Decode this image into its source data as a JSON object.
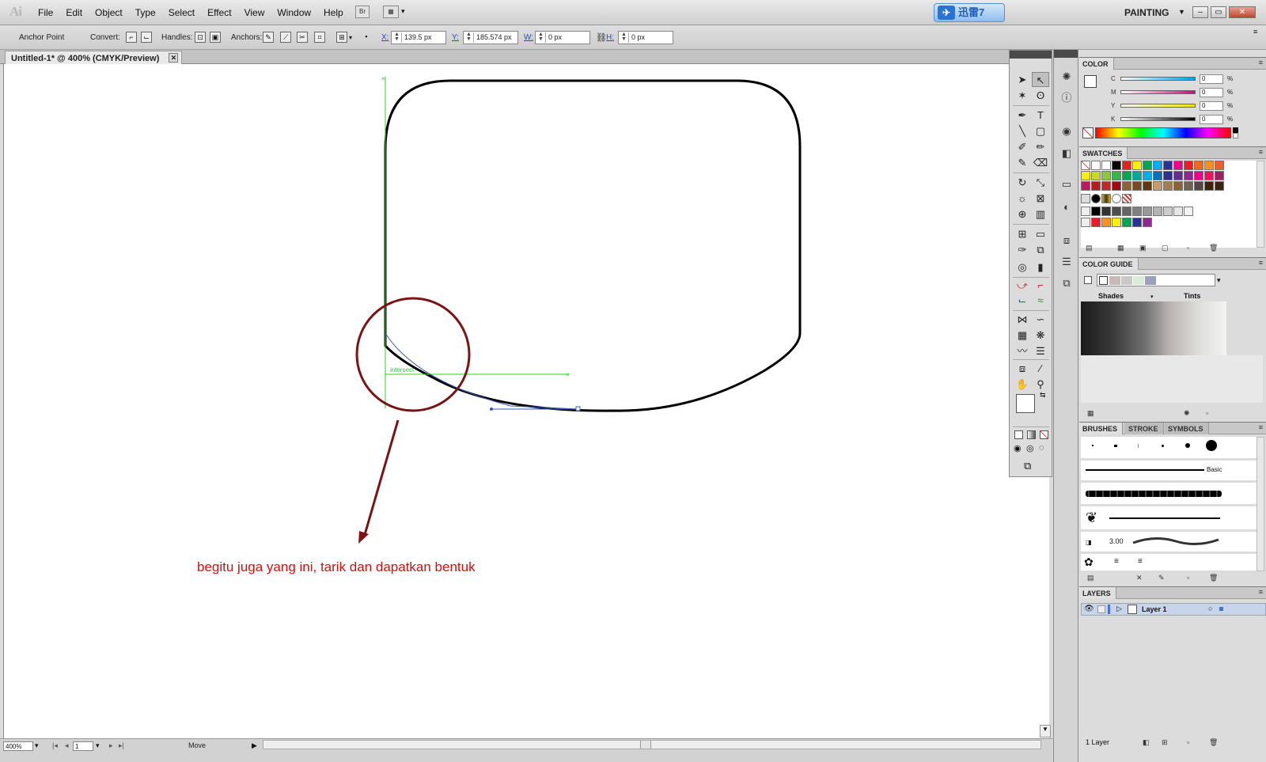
{
  "app": {
    "logo": "Ai",
    "menus": [
      "File",
      "Edit",
      "Object",
      "Type",
      "Select",
      "Effect",
      "View",
      "Window",
      "Help"
    ],
    "bridge_label": "Br",
    "tray_app": "迅雷7",
    "workspace": "PAINTING",
    "window_controls": [
      "–",
      "▭",
      "✕"
    ]
  },
  "control_bar": {
    "tool_name": "Anchor Point",
    "convert_label": "Convert:",
    "handles_label": "Handles:",
    "anchors_label": "Anchors:",
    "x_label": "X:",
    "x_value": "139.5 px",
    "y_label": "Y:",
    "y_value": "185.574 px",
    "w_label": "W:",
    "w_value": "0 px",
    "h_label": "H:",
    "h_value": "0 px"
  },
  "document": {
    "tab_title": "Untitled-1* @ 400% (CMYK/Preview)",
    "close": "✕",
    "smart_guide_label": "intersect",
    "annotation_text": "begitu juga yang ini, tarik dan dapatkan bentuk",
    "annotation_color": "#cc1111",
    "circle_color": "#7a1414"
  },
  "status_bar": {
    "zoom": "400%",
    "page": "1",
    "status_text": "Move"
  },
  "panels": {
    "color": {
      "title": "COLOR",
      "channels": [
        {
          "name": "C",
          "value": "0",
          "unit": "%"
        },
        {
          "name": "M",
          "value": "0",
          "unit": "%"
        },
        {
          "name": "Y",
          "value": "0",
          "unit": "%"
        },
        {
          "name": "K",
          "value": "0",
          "unit": "%"
        }
      ]
    },
    "swatches": {
      "title": "SWATCHES"
    },
    "color_guide": {
      "title": "COLOR GUIDE",
      "shades_label": "Shades",
      "tints_label": "Tints"
    },
    "brushes": {
      "tabs": [
        "BRUSHES",
        "STROKE",
        "SYMBOLS"
      ],
      "basic_label": "Basic",
      "size_value": "3.00"
    },
    "layers": {
      "title": "LAYERS",
      "layer_name": "Layer 1",
      "count_label": "1 Layer"
    }
  }
}
